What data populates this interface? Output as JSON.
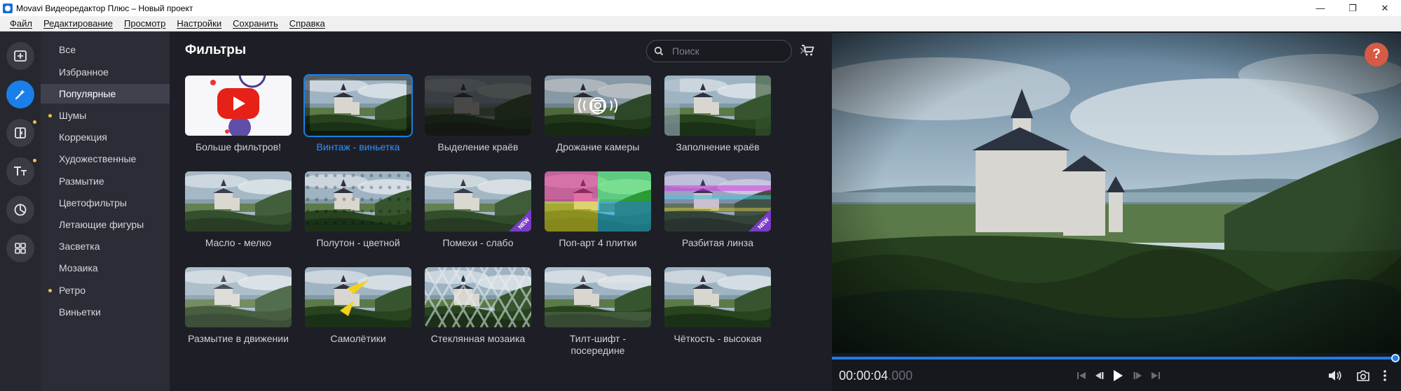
{
  "window": {
    "title": "Movavi Видеоредактор Плюс – Новый проект",
    "minimize": "—",
    "restore": "❐",
    "close": "✕"
  },
  "menu": [
    "Файл",
    "Редактирование",
    "Просмотр",
    "Настройки",
    "Сохранить",
    "Справка"
  ],
  "tools": [
    {
      "name": "import-icon",
      "active": false,
      "dot": false
    },
    {
      "name": "filters-magic-wand-icon",
      "active": true,
      "dot": false
    },
    {
      "name": "transitions-icon",
      "active": false,
      "dot": true
    },
    {
      "name": "titles-icon",
      "active": false,
      "dot": true
    },
    {
      "name": "stickers-icon",
      "active": false,
      "dot": false
    },
    {
      "name": "more-tools-icon",
      "active": false,
      "dot": false
    }
  ],
  "categories": [
    {
      "label": "Все",
      "dot": false,
      "active": false
    },
    {
      "label": "Избранное",
      "dot": false,
      "active": false
    },
    {
      "label": "Популярные",
      "dot": false,
      "active": true
    },
    {
      "label": "Шумы",
      "dot": true,
      "active": false
    },
    {
      "label": "Коррекция",
      "dot": false,
      "active": false
    },
    {
      "label": "Художественные",
      "dot": false,
      "active": false
    },
    {
      "label": "Размытие",
      "dot": false,
      "active": false
    },
    {
      "label": "Цветофильтры",
      "dot": false,
      "active": false
    },
    {
      "label": "Летающие фигуры",
      "dot": false,
      "active": false
    },
    {
      "label": "Засветка",
      "dot": false,
      "active": false
    },
    {
      "label": "Мозаика",
      "dot": false,
      "active": false
    },
    {
      "label": "Ретро",
      "dot": true,
      "active": false
    },
    {
      "label": "Виньетки",
      "dot": false,
      "active": false
    }
  ],
  "panel": {
    "title": "Фильтры",
    "search_placeholder": "Поиск"
  },
  "filters": [
    {
      "label": "Больше фильтров!",
      "selected": false,
      "new": false,
      "thumb": "youtube"
    },
    {
      "label": "Винтаж - виньетка",
      "selected": true,
      "new": false,
      "thumb": "vignette"
    },
    {
      "label": "Выделение краёв",
      "selected": false,
      "new": false,
      "thumb": "edges"
    },
    {
      "label": "Дрожание камеры",
      "selected": false,
      "new": false,
      "thumb": "camera"
    },
    {
      "label": "Заполнение краёв",
      "selected": false,
      "new": false,
      "thumb": "fill"
    },
    {
      "label": "Масло - мелко",
      "selected": false,
      "new": false,
      "thumb": "oil"
    },
    {
      "label": "Полутон - цветной",
      "selected": false,
      "new": false,
      "thumb": "halftone"
    },
    {
      "label": "Помехи - слабо",
      "selected": false,
      "new": true,
      "thumb": "noise"
    },
    {
      "label": "Поп-арт 4 плитки",
      "selected": false,
      "new": false,
      "thumb": "popart"
    },
    {
      "label": "Разбитая линза",
      "selected": false,
      "new": true,
      "thumb": "glitch"
    },
    {
      "label": "Размытие в движении",
      "selected": false,
      "new": false,
      "thumb": "motionblur"
    },
    {
      "label": "Самолётики",
      "selected": false,
      "new": false,
      "thumb": "planes"
    },
    {
      "label": "Стеклянная мозаика",
      "selected": false,
      "new": false,
      "thumb": "glass"
    },
    {
      "label": "Тилт-шифт - посередине",
      "selected": false,
      "new": false,
      "thumb": "tilt"
    },
    {
      "label": "Чёткость - высокая",
      "selected": false,
      "new": false,
      "thumb": "sharp"
    }
  ],
  "new_badge": "NEW",
  "preview": {
    "help": "?",
    "timecode": "00:00:04",
    "timecode_ms": ".000",
    "progress": 0.99
  },
  "colors": {
    "accent": "#1a7fe8",
    "dot": "#f0c040",
    "help": "#d65a45",
    "new_badge": "#7a3cc8"
  }
}
